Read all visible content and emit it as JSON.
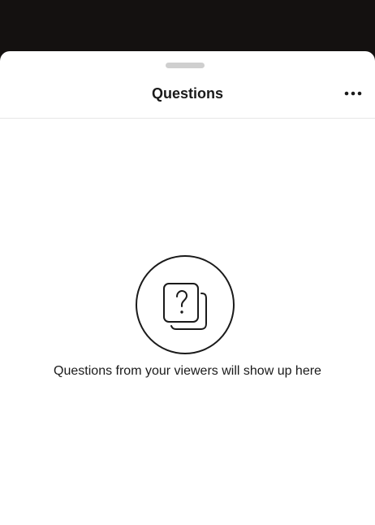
{
  "header": {
    "title": "Questions",
    "more_icon": "more-horizontal-icon"
  },
  "empty_state": {
    "icon": "question-cards-icon",
    "message": "Questions from your viewers will show up here"
  },
  "colors": {
    "backdrop": "#141110",
    "sheet": "#ffffff",
    "text": "#1a1a1a",
    "handle": "#cfcfcf",
    "divider": "#e6e6e6"
  }
}
